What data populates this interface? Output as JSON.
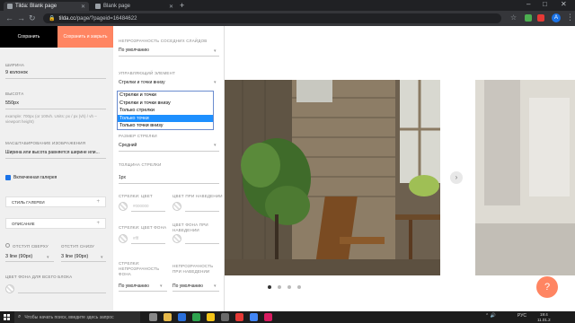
{
  "browser": {
    "tabs": [
      {
        "title": "Tilda: Blank page",
        "active": true
      },
      {
        "title": "Blank page",
        "active": false
      }
    ],
    "new_tab": "+",
    "window_controls": [
      "–",
      "□",
      "✕"
    ],
    "url_host": "tilda.cc",
    "url_path": "/page/?pageid=16484622",
    "profile_initial": "A"
  },
  "panel": {
    "save": "Сохранить",
    "save_close": "Сохранить и закрыть",
    "width_label": "Ширина",
    "width_value": "9 колонок",
    "height_label": "Высота",
    "height_value": "550px",
    "height_hint": "example: 700px (or 100vh. Units: px / px (vh) / vh – viewport height)",
    "scale_label": "Масштабирование изображения",
    "scale_value": "Ширина или высота равняется ширине или...",
    "fullscreen_checkbox": "Включенная галерея",
    "gallery_style": "Стиль галереи",
    "description": "Описание",
    "indent_top_label": "Отступ сверху",
    "indent_top_value": "3 line (90px)",
    "indent_bottom_label": "Отступ снизу",
    "indent_bottom_value": "3 line (90px)",
    "bg_color_label": "Цвет фона для всего блока"
  },
  "panel2": {
    "neighbor_opacity_label": "Непрозрачность соседних слайдов",
    "neighbor_opacity_value": "По умолчанию",
    "control_label": "Управляющий элемент",
    "control_value": "Стрелки и точки внизу",
    "dropdown_options": [
      "Стрелки и точки",
      "Стрелки и точки внизу",
      "Только стрелки",
      "Только точки",
      "Только точки внизу"
    ],
    "dropdown_selected_index": 3,
    "arrow_size_label": "Размер стрелки",
    "arrow_size_value": "Средний",
    "arrow_thickness_label": "Толщина стрелки",
    "arrow_thickness_value": "1px",
    "arrows_color_label": "Стрелки: цвет",
    "arrows_color_value": "#000000",
    "arrows_hover_label": "Цвет при наведении",
    "arrows_bg_label": "Стрелки: цвет фона",
    "arrows_bg_value": "#fff",
    "arrows_bg_hover_label": "Цвет фона при наведении",
    "arrows_opacity_label": "Стрелки: непрозрачность фона",
    "arrows_opacity_value": "По умолчанию",
    "arrows_opacity_hover_label": "Непрозрачность при наведении",
    "arrows_opacity_hover_value": "По умолчанию"
  },
  "preview": {
    "arrow": "›",
    "dots_count": 4,
    "active_dot": 0,
    "fab_icon": "?"
  },
  "taskbar": {
    "search_placeholder": "Чтобы начать поиск, введите здесь запрос",
    "language": "РУС",
    "time": "19:4",
    "date": "11.01.2"
  },
  "colors": {
    "accent": "#ff8562",
    "selection": "#1e90ff",
    "chrome_dark": "#202124"
  }
}
